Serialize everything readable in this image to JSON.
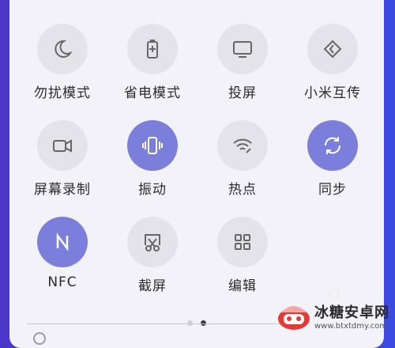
{
  "tiles": [
    {
      "label": "勿扰模式",
      "icon": "moon-icon",
      "active": false
    },
    {
      "label": "省电模式",
      "icon": "battery-icon",
      "active": false
    },
    {
      "label": "投屏",
      "icon": "monitor-icon",
      "active": false
    },
    {
      "label": "小米互传",
      "icon": "transfer-icon",
      "active": false
    },
    {
      "label": "屏幕录制",
      "icon": "video-icon",
      "active": false
    },
    {
      "label": "振动",
      "icon": "vibrate-icon",
      "active": true
    },
    {
      "label": "热点",
      "icon": "hotspot-icon",
      "active": false
    },
    {
      "label": "同步",
      "icon": "sync-icon",
      "active": true
    },
    {
      "label": "NFC",
      "icon": "nfc-icon",
      "active": true
    },
    {
      "label": "截屏",
      "icon": "screenshot-icon",
      "active": false
    },
    {
      "label": "编辑",
      "icon": "grid-icon",
      "active": false
    }
  ],
  "pager": {
    "pages": 2,
    "current": 2
  },
  "watermark": {
    "title": "冰糖安卓网",
    "url": "www.btxtdmy.com"
  },
  "colors": {
    "active": "#7b7fdb",
    "inactive": "#e4e3e9",
    "panel": "#f3f2f8"
  }
}
